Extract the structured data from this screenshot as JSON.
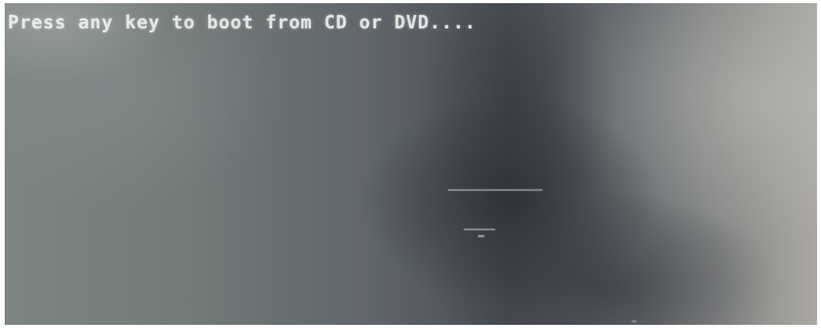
{
  "console": {
    "boot_message": "Press any key to boot from CD or DVD...."
  },
  "colors": {
    "text": "#eef0ee",
    "screen_dark": "#4a4e55",
    "screen_light": "#a9a8a3"
  }
}
